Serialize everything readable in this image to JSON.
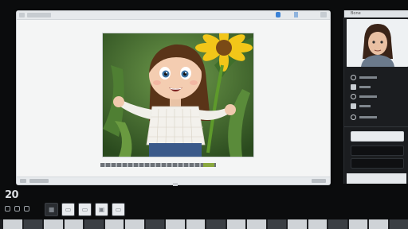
{
  "clock": {
    "time": "20"
  },
  "side_panel": {
    "title": "Bone"
  },
  "colors": {
    "accent": "#3b82d6",
    "panel_bg": "#1b1d20",
    "window_bg": "#f4f5f5"
  }
}
